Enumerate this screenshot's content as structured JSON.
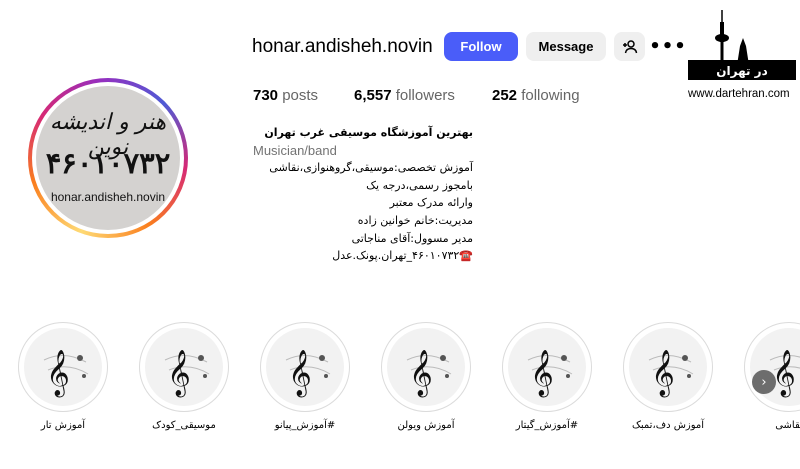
{
  "profile": {
    "username": "honar.andisheh.novin",
    "avatar": {
      "script_text": "هنر و اندیشه نوین",
      "number_text": "۴۶۰۱۰۷۳۲",
      "url_text": "honar.andisheh.novin"
    }
  },
  "actions": {
    "follow_label": "Follow",
    "message_label": "Message",
    "add_user_icon": "add-person-icon",
    "more_label": "•••"
  },
  "stats": {
    "posts_count": "730",
    "posts_label": "posts",
    "followers_count": "6,557",
    "followers_label": "followers",
    "following_count": "252",
    "following_label": "following"
  },
  "bio": {
    "title": "بهترین آموزشگاه موسیقی غرب تهران",
    "category": "Musician/band",
    "lines": [
      "آموزش تخصصی:موسیقی،گروهنوازی،نقاشی",
      "بامجوز رسمی،درجه یک",
      "وارائه مدرک معتبر",
      "مدیریت:خانم خوانین زاده",
      "مدیر مسوول:آقای مناجاتی",
      "☎️۴۶۰۱۰۷۳۲_تهران.پونک.عدل"
    ]
  },
  "watermark": {
    "logo_text": "در تهران",
    "url": "www.dartehran.com"
  },
  "highlights": [
    {
      "label": "آموزش تار"
    },
    {
      "label": "موسیقی_کودک"
    },
    {
      "label": "#آموزش_پیانو"
    },
    {
      "label": "آموزش ویولن"
    },
    {
      "label": "#آموزش_گیتار"
    },
    {
      "label": "آموزش دف،تمبک"
    },
    {
      "label": "نقاشی"
    }
  ],
  "colors": {
    "follow_button": "#4a5df9",
    "secondary_button": "#efefef",
    "muted_text": "#737373"
  }
}
